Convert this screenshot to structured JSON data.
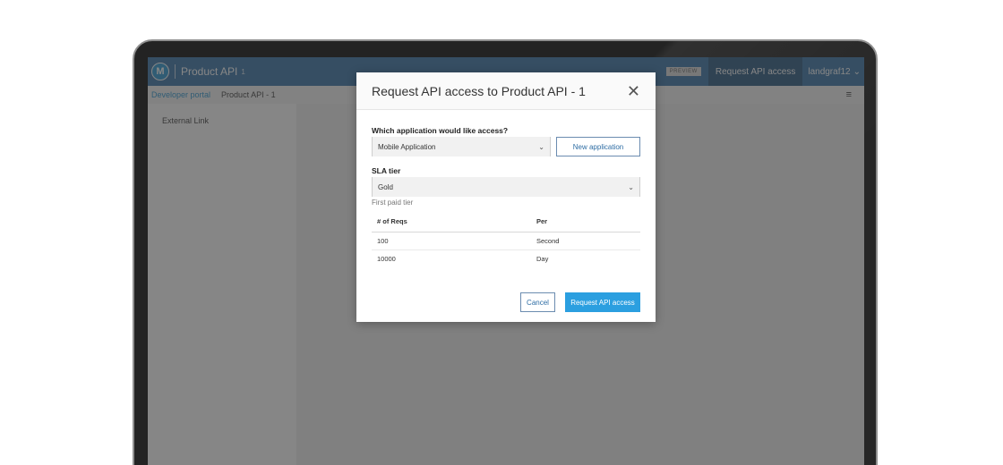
{
  "topbar": {
    "logo_letter": "M",
    "app_title": "Product API",
    "app_version": "1",
    "preview_badge": "PREVIEW",
    "request_button": "Request API access",
    "username": "landgraf12",
    "user_chevron": "⌄"
  },
  "subnav": {
    "portal_link": "Developer portal",
    "current": "Product API - 1",
    "menu_icon": "≡"
  },
  "sidebar": {
    "external_link": "External Link"
  },
  "modal": {
    "title": "Request API access to Product API - 1",
    "close_glyph": "✕",
    "app_label": "Which application would like access?",
    "app_value": "Mobile Application",
    "new_app_button": "New application",
    "sla_label": "SLA tier",
    "sla_value": "Gold",
    "tier_description": "First paid tier",
    "table": {
      "headers": [
        "# of Reqs",
        "Per"
      ],
      "rows": [
        [
          "100",
          "Second"
        ],
        [
          "10000",
          "Day"
        ]
      ]
    },
    "cancel_button": "Cancel",
    "submit_button": "Request API access"
  },
  "colors": {
    "topbar": "#2e6da4",
    "accent": "#2b9fe0",
    "bezel": "#232323"
  }
}
